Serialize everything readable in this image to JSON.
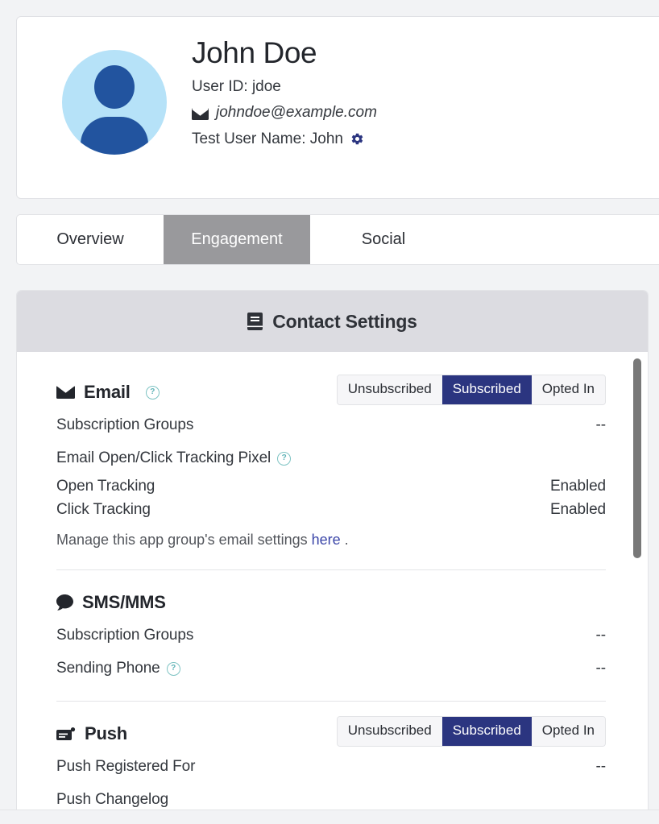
{
  "profile": {
    "name": "John Doe",
    "user_id_line": "User ID: jdoe",
    "email": "johndoe@example.com",
    "email_icon": "envelope-icon",
    "test_user_name_line": "Test User Name: John",
    "gear_icon": "gear-icon",
    "avatar_icon": "user-avatar-icon",
    "avatar_bg_color": "#b6e2f8",
    "avatar_fg_color": "#22549f"
  },
  "tabs": {
    "items": [
      {
        "label": "Overview",
        "active": false
      },
      {
        "label": "Engagement",
        "active": true
      },
      {
        "label": "Social",
        "active": false
      }
    ],
    "active_bg_color": "#99999c"
  },
  "contact_settings": {
    "header": {
      "icon": "address-book-icon",
      "title": "Contact Settings",
      "bg_color": "#dcdce1"
    },
    "selected_color": "#2b3580",
    "help_icon_color": "#5fb3b7",
    "link_color": "#3b46a8",
    "sections": [
      {
        "id": "email",
        "icon": "envelope-icon",
        "title": "Email",
        "has_help": true,
        "help_icon": "question-mark-icon",
        "segmented": {
          "options": [
            "Unsubscribed",
            "Subscribed",
            "Opted In"
          ],
          "selected": "Subscribed"
        },
        "rows": [
          {
            "label": "Subscription Groups",
            "value": "--",
            "help": false
          },
          {
            "label": "Email Open/Click Tracking Pixel",
            "value": "",
            "help": true
          },
          {
            "label": "Open Tracking",
            "value": "Enabled",
            "help": false,
            "indent": true
          },
          {
            "label": "Click Tracking",
            "value": "Enabled",
            "help": false,
            "indent": true
          }
        ],
        "note": {
          "prefix": "Manage this app group's email settings ",
          "link": "here",
          "suffix": " ."
        }
      },
      {
        "id": "sms-mms",
        "icon": "chat-bubble-icon",
        "title": "SMS/MMS",
        "has_help": false,
        "segmented": null,
        "rows": [
          {
            "label": "Subscription Groups",
            "value": "--",
            "help": false
          },
          {
            "label": "Sending Phone",
            "value": "--",
            "help": true
          }
        ],
        "note": null
      },
      {
        "id": "push",
        "icon": "push-notification-icon",
        "title": "Push",
        "has_help": false,
        "segmented": {
          "options": [
            "Unsubscribed",
            "Subscribed",
            "Opted In"
          ],
          "selected": "Subscribed"
        },
        "rows": [
          {
            "label": "Push Registered For",
            "value": "--",
            "help": false
          },
          {
            "label": "Push Changelog",
            "value": "",
            "help": false
          }
        ],
        "note": null
      }
    ],
    "scrollbar": {
      "name": "vertical-scrollbar",
      "thumb_color": "#787878"
    }
  }
}
